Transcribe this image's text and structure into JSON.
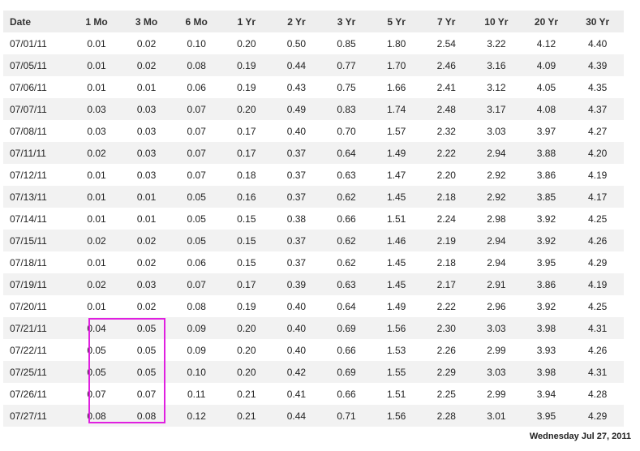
{
  "table": {
    "headers": [
      "Date",
      "1 Mo",
      "3 Mo",
      "6 Mo",
      "1 Yr",
      "2 Yr",
      "3 Yr",
      "5 Yr",
      "7 Yr",
      "10 Yr",
      "20 Yr",
      "30 Yr"
    ],
    "rows": [
      [
        "07/01/11",
        "0.01",
        "0.02",
        "0.10",
        "0.20",
        "0.50",
        "0.85",
        "1.80",
        "2.54",
        "3.22",
        "4.12",
        "4.40"
      ],
      [
        "07/05/11",
        "0.01",
        "0.02",
        "0.08",
        "0.19",
        "0.44",
        "0.77",
        "1.70",
        "2.46",
        "3.16",
        "4.09",
        "4.39"
      ],
      [
        "07/06/11",
        "0.01",
        "0.01",
        "0.06",
        "0.19",
        "0.43",
        "0.75",
        "1.66",
        "2.41",
        "3.12",
        "4.05",
        "4.35"
      ],
      [
        "07/07/11",
        "0.03",
        "0.03",
        "0.07",
        "0.20",
        "0.49",
        "0.83",
        "1.74",
        "2.48",
        "3.17",
        "4.08",
        "4.37"
      ],
      [
        "07/08/11",
        "0.03",
        "0.03",
        "0.07",
        "0.17",
        "0.40",
        "0.70",
        "1.57",
        "2.32",
        "3.03",
        "3.97",
        "4.27"
      ],
      [
        "07/11/11",
        "0.02",
        "0.03",
        "0.07",
        "0.17",
        "0.37",
        "0.64",
        "1.49",
        "2.22",
        "2.94",
        "3.88",
        "4.20"
      ],
      [
        "07/12/11",
        "0.01",
        "0.03",
        "0.07",
        "0.18",
        "0.37",
        "0.63",
        "1.47",
        "2.20",
        "2.92",
        "3.86",
        "4.19"
      ],
      [
        "07/13/11",
        "0.01",
        "0.01",
        "0.05",
        "0.16",
        "0.37",
        "0.62",
        "1.45",
        "2.18",
        "2.92",
        "3.85",
        "4.17"
      ],
      [
        "07/14/11",
        "0.01",
        "0.01",
        "0.05",
        "0.15",
        "0.38",
        "0.66",
        "1.51",
        "2.24",
        "2.98",
        "3.92",
        "4.25"
      ],
      [
        "07/15/11",
        "0.02",
        "0.02",
        "0.05",
        "0.15",
        "0.37",
        "0.62",
        "1.46",
        "2.19",
        "2.94",
        "3.92",
        "4.26"
      ],
      [
        "07/18/11",
        "0.01",
        "0.02",
        "0.06",
        "0.15",
        "0.37",
        "0.62",
        "1.45",
        "2.18",
        "2.94",
        "3.95",
        "4.29"
      ],
      [
        "07/19/11",
        "0.02",
        "0.03",
        "0.07",
        "0.17",
        "0.39",
        "0.63",
        "1.45",
        "2.17",
        "2.91",
        "3.86",
        "4.19"
      ],
      [
        "07/20/11",
        "0.01",
        "0.02",
        "0.08",
        "0.19",
        "0.40",
        "0.64",
        "1.49",
        "2.22",
        "2.96",
        "3.92",
        "4.25"
      ],
      [
        "07/21/11",
        "0.04",
        "0.05",
        "0.09",
        "0.20",
        "0.40",
        "0.69",
        "1.56",
        "2.30",
        "3.03",
        "3.98",
        "4.31"
      ],
      [
        "07/22/11",
        "0.05",
        "0.05",
        "0.09",
        "0.20",
        "0.40",
        "0.66",
        "1.53",
        "2.26",
        "2.99",
        "3.93",
        "4.26"
      ],
      [
        "07/25/11",
        "0.05",
        "0.05",
        "0.10",
        "0.20",
        "0.42",
        "0.69",
        "1.55",
        "2.29",
        "3.03",
        "3.98",
        "4.31"
      ],
      [
        "07/26/11",
        "0.07",
        "0.07",
        "0.11",
        "0.21",
        "0.41",
        "0.66",
        "1.51",
        "2.25",
        "2.99",
        "3.94",
        "4.28"
      ],
      [
        "07/27/11",
        "0.08",
        "0.08",
        "0.12",
        "0.21",
        "0.44",
        "0.71",
        "1.56",
        "2.28",
        "3.01",
        "3.95",
        "4.29"
      ]
    ]
  },
  "highlight": {
    "color": "#e020e0",
    "rows": [
      "07/21/11",
      "07/22/11",
      "07/25/11",
      "07/26/11",
      "07/27/11"
    ],
    "columns": [
      "1 Mo",
      "3 Mo"
    ]
  },
  "footer": {
    "date": "Wednesday Jul 27, 2011"
  },
  "colors": {
    "header_bg": "#eeeeee",
    "stripe_bg": "#f2f2f2",
    "text": "#222222"
  }
}
